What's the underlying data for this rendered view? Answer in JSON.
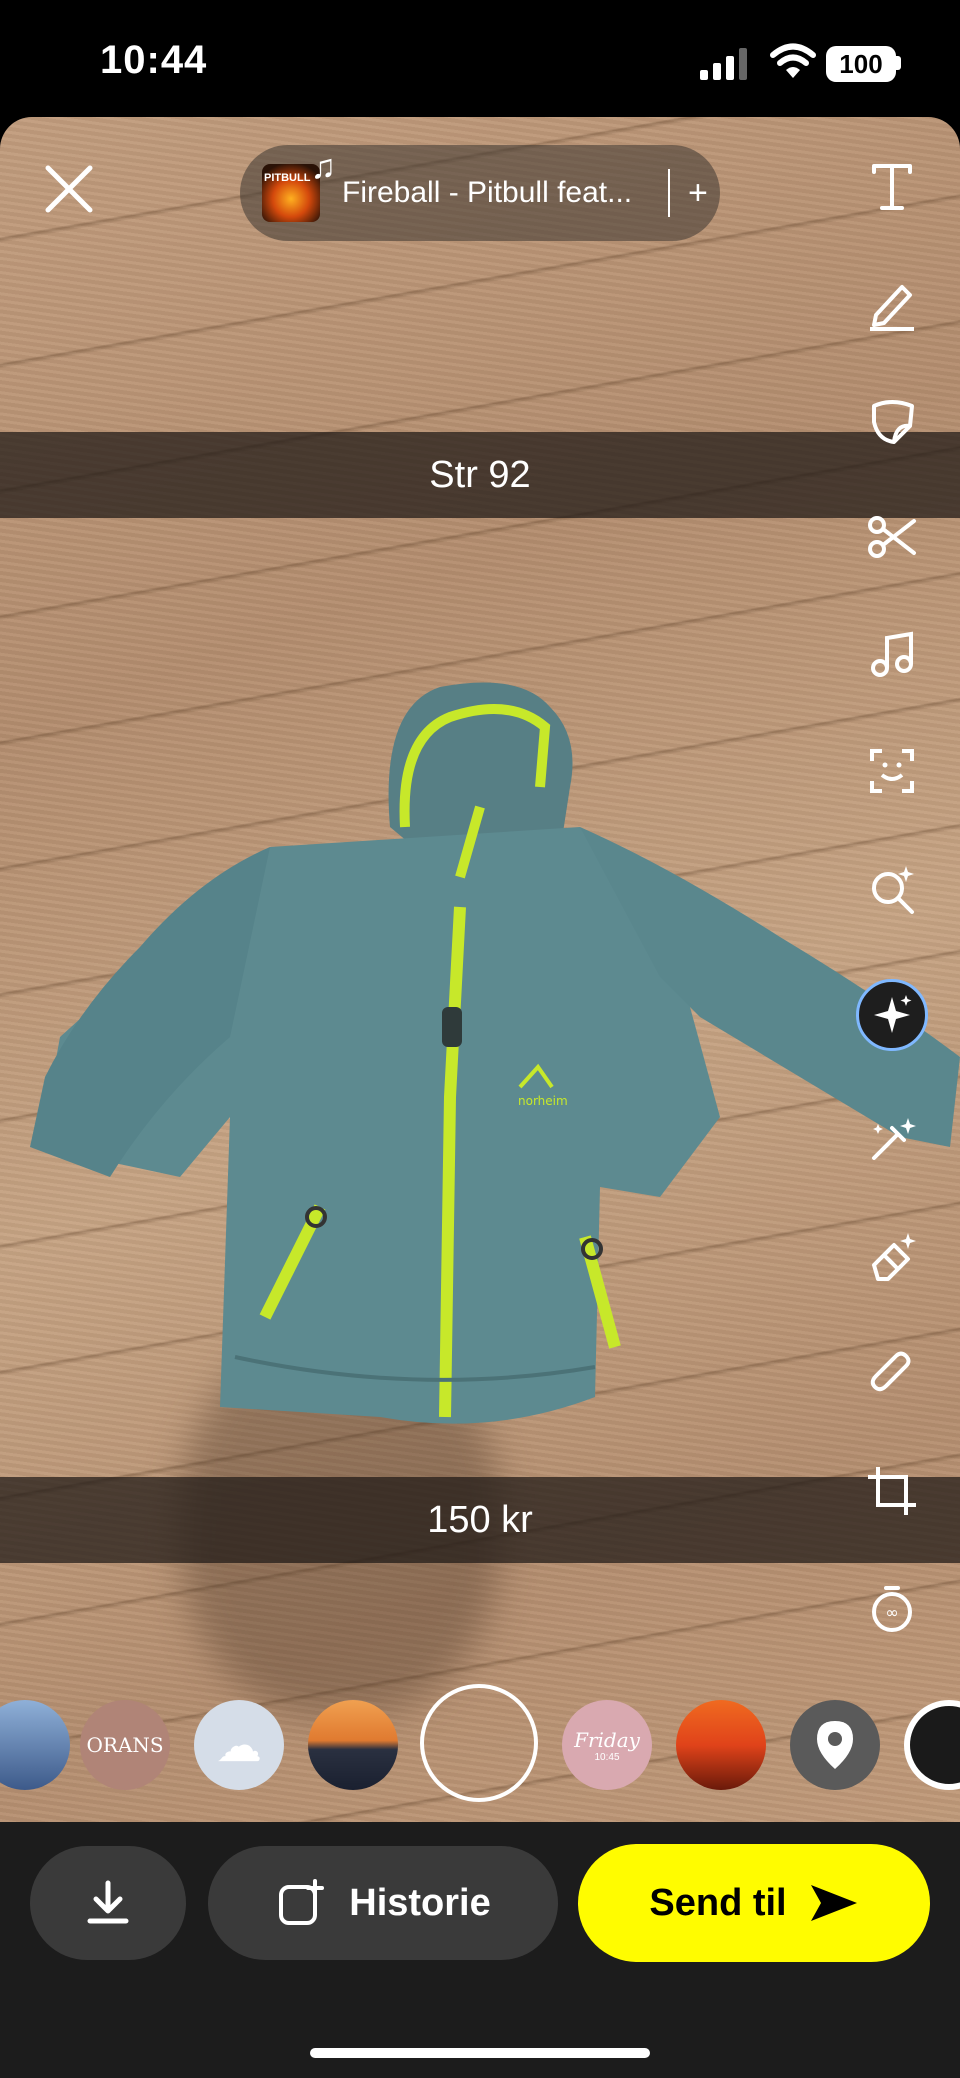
{
  "status_bar": {
    "time": "10:44",
    "battery": "100"
  },
  "music": {
    "song": "Fireball - Pitbull feat...",
    "album_label": "PITBULL",
    "add_symbol": "+"
  },
  "captions": {
    "top": "Str 92",
    "bottom": "150 kr"
  },
  "toolbar": {
    "items": [
      "text-icon",
      "pen-icon",
      "sticker-icon",
      "scissors-icon",
      "music-icon",
      "scan-icon",
      "lens-search-icon",
      "ai-sparkle-icon",
      "magic-wand-icon",
      "eraser-icon",
      "paperclip-icon",
      "crop-icon",
      "timer-icon"
    ]
  },
  "lenses": [
    {
      "name": "lens-city",
      "color": "#4a6fa5"
    },
    {
      "name": "lens-orans",
      "text": "ORANS",
      "color": "#b08477"
    },
    {
      "name": "lens-weather",
      "color": "#d5dde8"
    },
    {
      "name": "lens-sunset",
      "color": "#e07a30"
    },
    {
      "name": "lens-friday",
      "text": "Friday",
      "sub": "10:45",
      "color": "#d9a9b0"
    },
    {
      "name": "lens-red-sunset",
      "color": "#e0431a"
    },
    {
      "name": "lens-location",
      "color": "#5a5a5a"
    }
  ],
  "bottom_bar": {
    "story_label": "Historie",
    "send_label": "Send til"
  },
  "colors": {
    "accent_yellow": "#FFFC00",
    "jacket": "#5d8a90",
    "zipper": "#c7e82a"
  }
}
